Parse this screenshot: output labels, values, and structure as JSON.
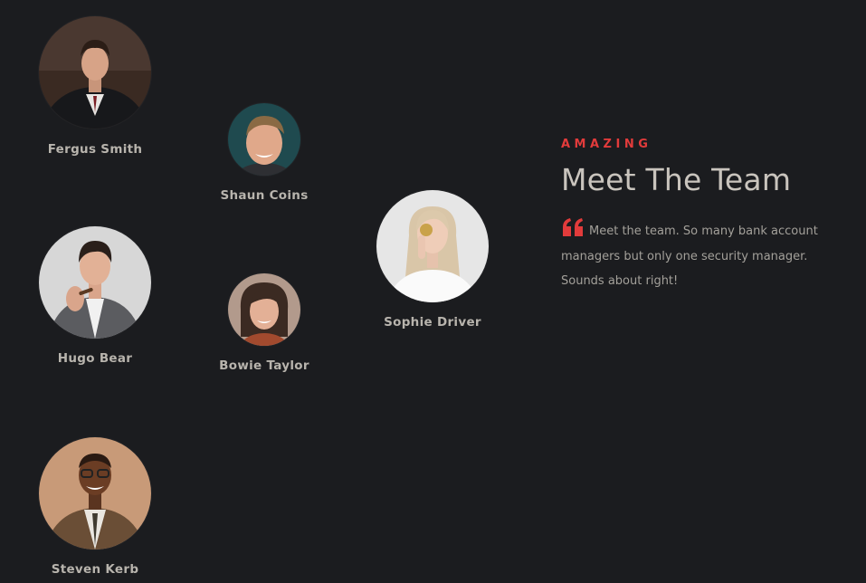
{
  "team": {
    "members": [
      {
        "name": "Fergus Smith"
      },
      {
        "name": "Shaun Coins"
      },
      {
        "name": "Hugo Bear"
      },
      {
        "name": "Bowie Taylor"
      },
      {
        "name": "Sophie Driver"
      },
      {
        "name": "Steven Kerb"
      }
    ]
  },
  "intro": {
    "eyebrow": "AMAZING",
    "heading": "Meet The Team",
    "quote": "Meet the team. So many bank account managers but only one security manager. Sounds about right!",
    "quote_icon": "quote-left-icon"
  },
  "colors": {
    "background": "#1b1c1f",
    "accent": "#e23b3b",
    "heading": "#c9c4bd",
    "body_text": "#a3a09a",
    "name_text": "#b8b4ad"
  }
}
